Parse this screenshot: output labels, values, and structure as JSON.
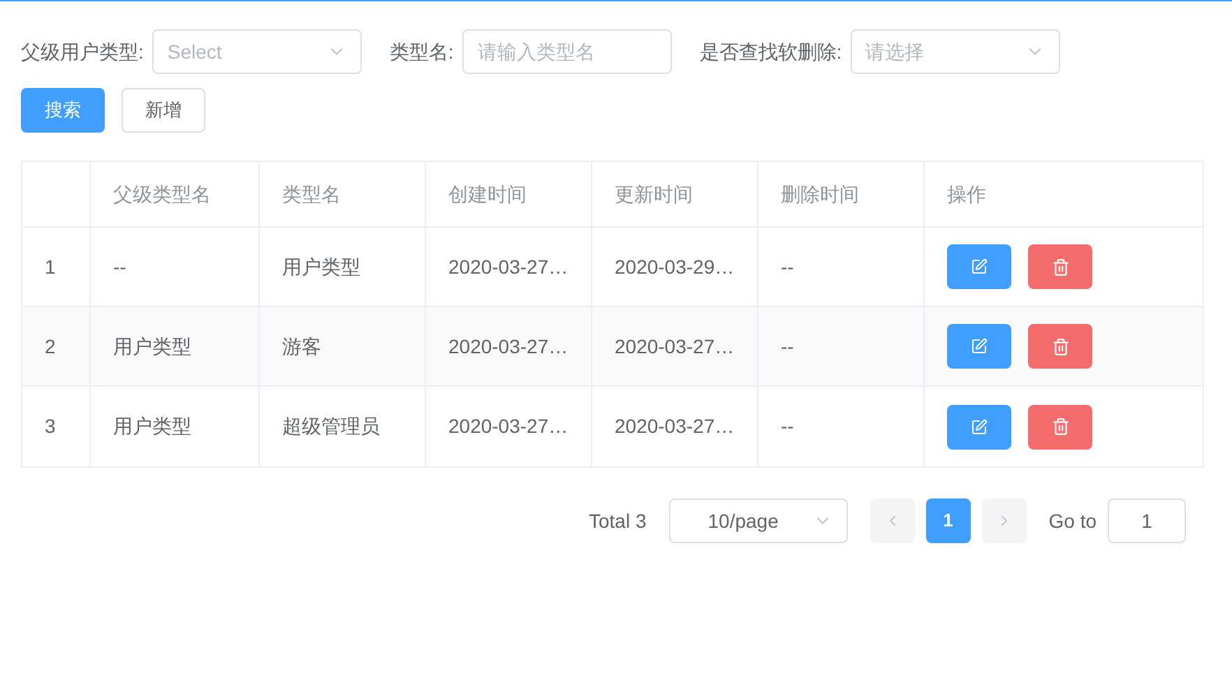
{
  "filters": [
    {
      "label": "父级用户类型:",
      "kind": "select",
      "placeholder": "Select"
    },
    {
      "label": "类型名:",
      "kind": "input",
      "placeholder": "请输入类型名"
    },
    {
      "label": "是否查找软删除:",
      "kind": "select",
      "placeholder": "请选择"
    }
  ],
  "buttons": [
    {
      "label": "搜索",
      "kind": "primary"
    },
    {
      "label": "新增",
      "kind": "default"
    }
  ],
  "table": {
    "columns": [
      "",
      "父级类型名",
      "类型名",
      "创建时间",
      "更新时间",
      "删除时间",
      "操作"
    ],
    "rows": [
      {
        "cells": [
          "1",
          "--",
          "用户类型",
          "2020-03-27…",
          "2020-03-29…",
          "--"
        ]
      },
      {
        "cells": [
          "2",
          "用户类型",
          "游客",
          "2020-03-27…",
          "2020-03-27…",
          "--"
        ]
      },
      {
        "cells": [
          "3",
          "用户类型",
          "超级管理员",
          "2020-03-27…",
          "2020-03-27…",
          "--"
        ]
      }
    ]
  },
  "pagination": {
    "total": "Total 3",
    "page_size": "10/page",
    "pages": [
      {
        "label": "1",
        "selected": true
      }
    ],
    "goto_label": "Go to",
    "goto_value": "1"
  }
}
